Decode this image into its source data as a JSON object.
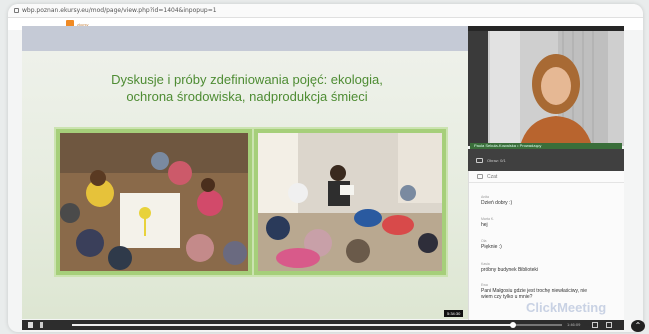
{
  "browser": {
    "url": "wbp.poznan.ekursy.eu/mod/page/view.php?id=1404&inpopup=1"
  },
  "site": {
    "logo_text": "zkursy"
  },
  "slide": {
    "title_line1": "Dyskusje i próby zdefiniowania pojęć: ekologia,",
    "title_line2": "ochrona środowiska, nadprodukcja śmieci"
  },
  "webcam": {
    "name_label": "Paula Sekuła-Kowalska • Prowadzący",
    "camera_label": "Obraz: 0/1"
  },
  "chat": {
    "title": "Czat",
    "messages": [
      {
        "author": "Anita",
        "text": "Dzień dobry :)"
      },
      {
        "author": "Marta K.",
        "text": "hej"
      },
      {
        "author": "Ola",
        "text": "Pięknie :)"
      },
      {
        "author": "Kasia",
        "text": "próbny budynek Biblioteki"
      },
      {
        "author": "Ewa",
        "text": "Pani Małgosiu gdzie jest trochę niewłaściwy, nie"
      },
      {
        "author": "",
        "text": "wiem czy tylko u mnie?"
      }
    ]
  },
  "watermark": "ClickMeeting",
  "player": {
    "time_current": "5:34:30",
    "time_right": "1:46:09",
    "progress": 0.9
  },
  "colors": {
    "title_green": "#4e8c33",
    "photo_border": "#a6cf7a"
  }
}
